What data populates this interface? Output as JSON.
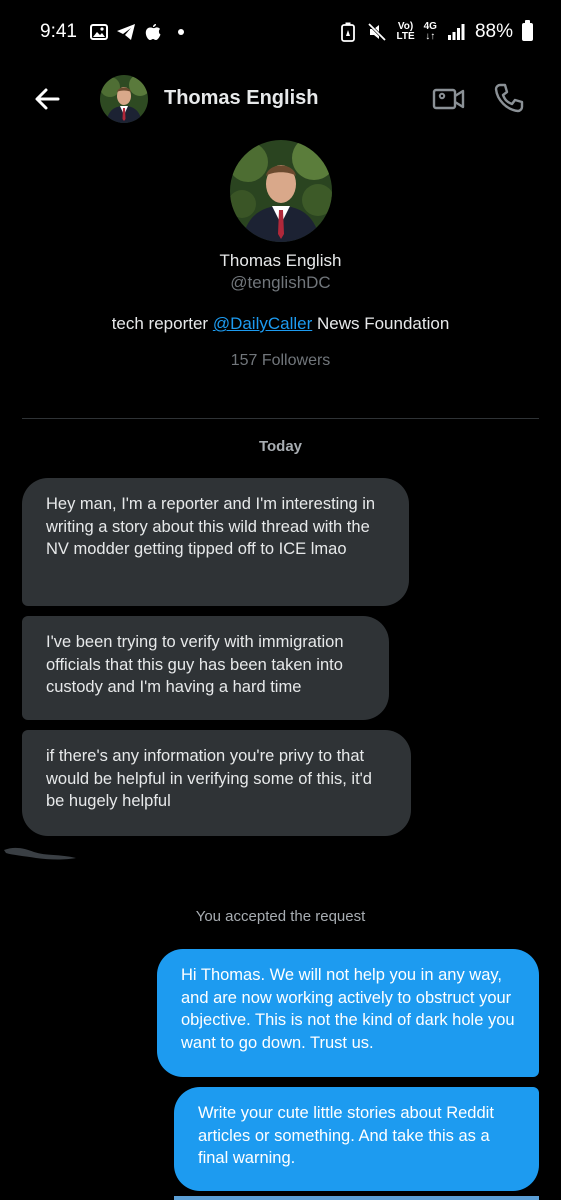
{
  "status_bar": {
    "time": "9:41",
    "net_top": "4G",
    "net_volte_top": "Vo)",
    "net_volte_bottom": "LTE",
    "battery_percent": "88%",
    "left_icons": [
      "gallery-icon",
      "telegram-icon",
      "apple-icon",
      "notification-dot"
    ],
    "right_icons": [
      "battery-saver-icon",
      "mute-icon",
      "volte-icon",
      "network-4g-icon",
      "signal-icon",
      "battery-icon"
    ]
  },
  "header": {
    "contact_name": "Thomas English",
    "back_icon": "arrow-left-icon",
    "video_icon": "video-call-icon",
    "phone_icon": "phone-call-icon"
  },
  "profile": {
    "name": "Thomas English",
    "handle": "@tenglishDC",
    "bio_prefix": "tech reporter ",
    "bio_link": "@DailyCaller",
    "bio_suffix": " News Foundation",
    "followers": "157 Followers"
  },
  "conversation": {
    "day_label": "Today",
    "incoming": [
      "Hey man, I'm a reporter and I'm interesting in writing a story about this wild thread with the NV modder getting tipped off to ICE lmao",
      "I've been trying to verify with immigration officials that this guy has been taken into custody and I'm having a hard time",
      "if there's any information you're privy to that would be helpful in verifying some of this, it'd be hugely helpful"
    ],
    "system_note": "You accepted the request",
    "outgoing": [
      "Hi Thomas. We will not help you in any way, and are now working actively to obstruct your objective. This is not the kind of dark hole you want to go down. Trust us.",
      "Write your cute little stories about Reddit articles or something. And take this as a final warning."
    ]
  },
  "colors": {
    "background": "#000000",
    "incoming_bubble": "#2f3336",
    "outgoing_bubble": "#1d9bf0",
    "link": "#1d9bf0",
    "secondary_text": "#71767b"
  }
}
